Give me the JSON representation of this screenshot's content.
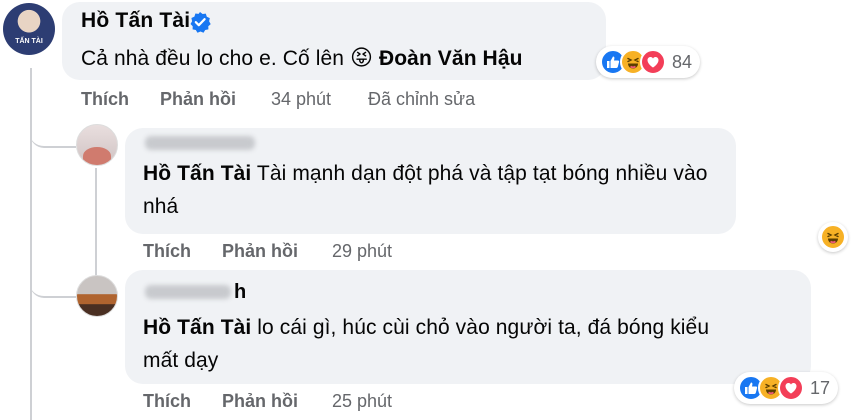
{
  "comments": [
    {
      "author": "Hồ Tấn Tài",
      "verified": true,
      "avatar_caption": "TẤN TÀI",
      "text": "Cả nhà đều lo cho e. Cố lên",
      "emoji": "😝",
      "mention": "Đoàn Văn Hậu",
      "reaction_count": "84",
      "like_label": "Thích",
      "reply_label": "Phản hồi",
      "time": "34 phút",
      "edited": "Đã chỉnh sửa"
    },
    {
      "mention": "Hồ Tấn Tài",
      "text_line1": "Tài mạnh dạn đột phá và tập tạt bóng nhiều vào",
      "text_line2": "nhá",
      "like_label": "Thích",
      "reply_label": "Phản hồi",
      "time": "29 phút"
    },
    {
      "author_partial": "h",
      "mention": "Hồ Tấn Tài",
      "text_line1": "lo cái gì, húc cùi chỏ vào người ta, đá bóng kiểu",
      "text_line2": "mất dạy",
      "reaction_count": "17",
      "like_label": "Thích",
      "reply_label": "Phản hồi",
      "time": "25 phút"
    }
  ],
  "icons": {
    "verified": "verified-badge-icon",
    "like": "like-reaction-icon",
    "haha": "haha-reaction-icon",
    "love": "love-reaction-icon"
  },
  "colors": {
    "bubble": "#f0f2f5",
    "meta": "#65676b",
    "like": "#1877f2",
    "haha": "#f7b125",
    "love": "#f33e58",
    "verified": "#1877f2"
  }
}
